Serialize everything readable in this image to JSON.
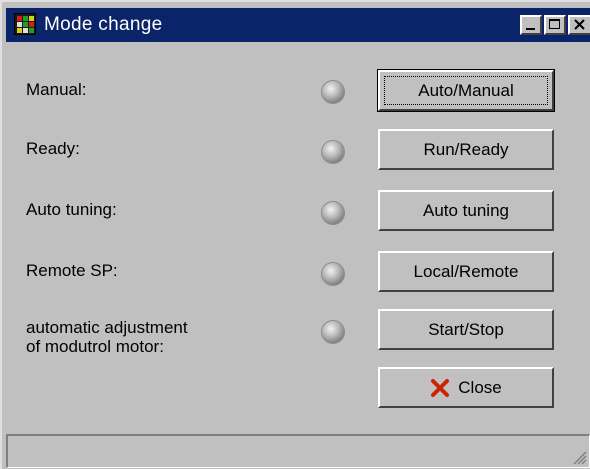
{
  "window": {
    "title": "Mode change",
    "title_bar_color": "#0a246a",
    "icons": {
      "app": "panel-app-icon",
      "minimize": "minimize-icon",
      "maximize": "maximize-icon",
      "close": "close-icon"
    }
  },
  "rows": [
    {
      "label": "Manual:",
      "indicator": "gray",
      "button": "Auto/Manual"
    },
    {
      "label": "Ready:",
      "indicator": "gray",
      "button": "Run/Ready"
    },
    {
      "label": "Auto tuning:",
      "indicator": "gray",
      "button": "Auto tuning"
    },
    {
      "label": "Remote SP:",
      "indicator": "gray",
      "button": "Local/Remote"
    },
    {
      "label": "automatic adjustment\nof modutrol motor:",
      "indicator": "gray",
      "button": "Start/Stop"
    }
  ],
  "close_button": {
    "label": "Close",
    "icon": "red-x-icon",
    "icon_color": "#cc2200"
  },
  "status_bar": {
    "text": ""
  }
}
